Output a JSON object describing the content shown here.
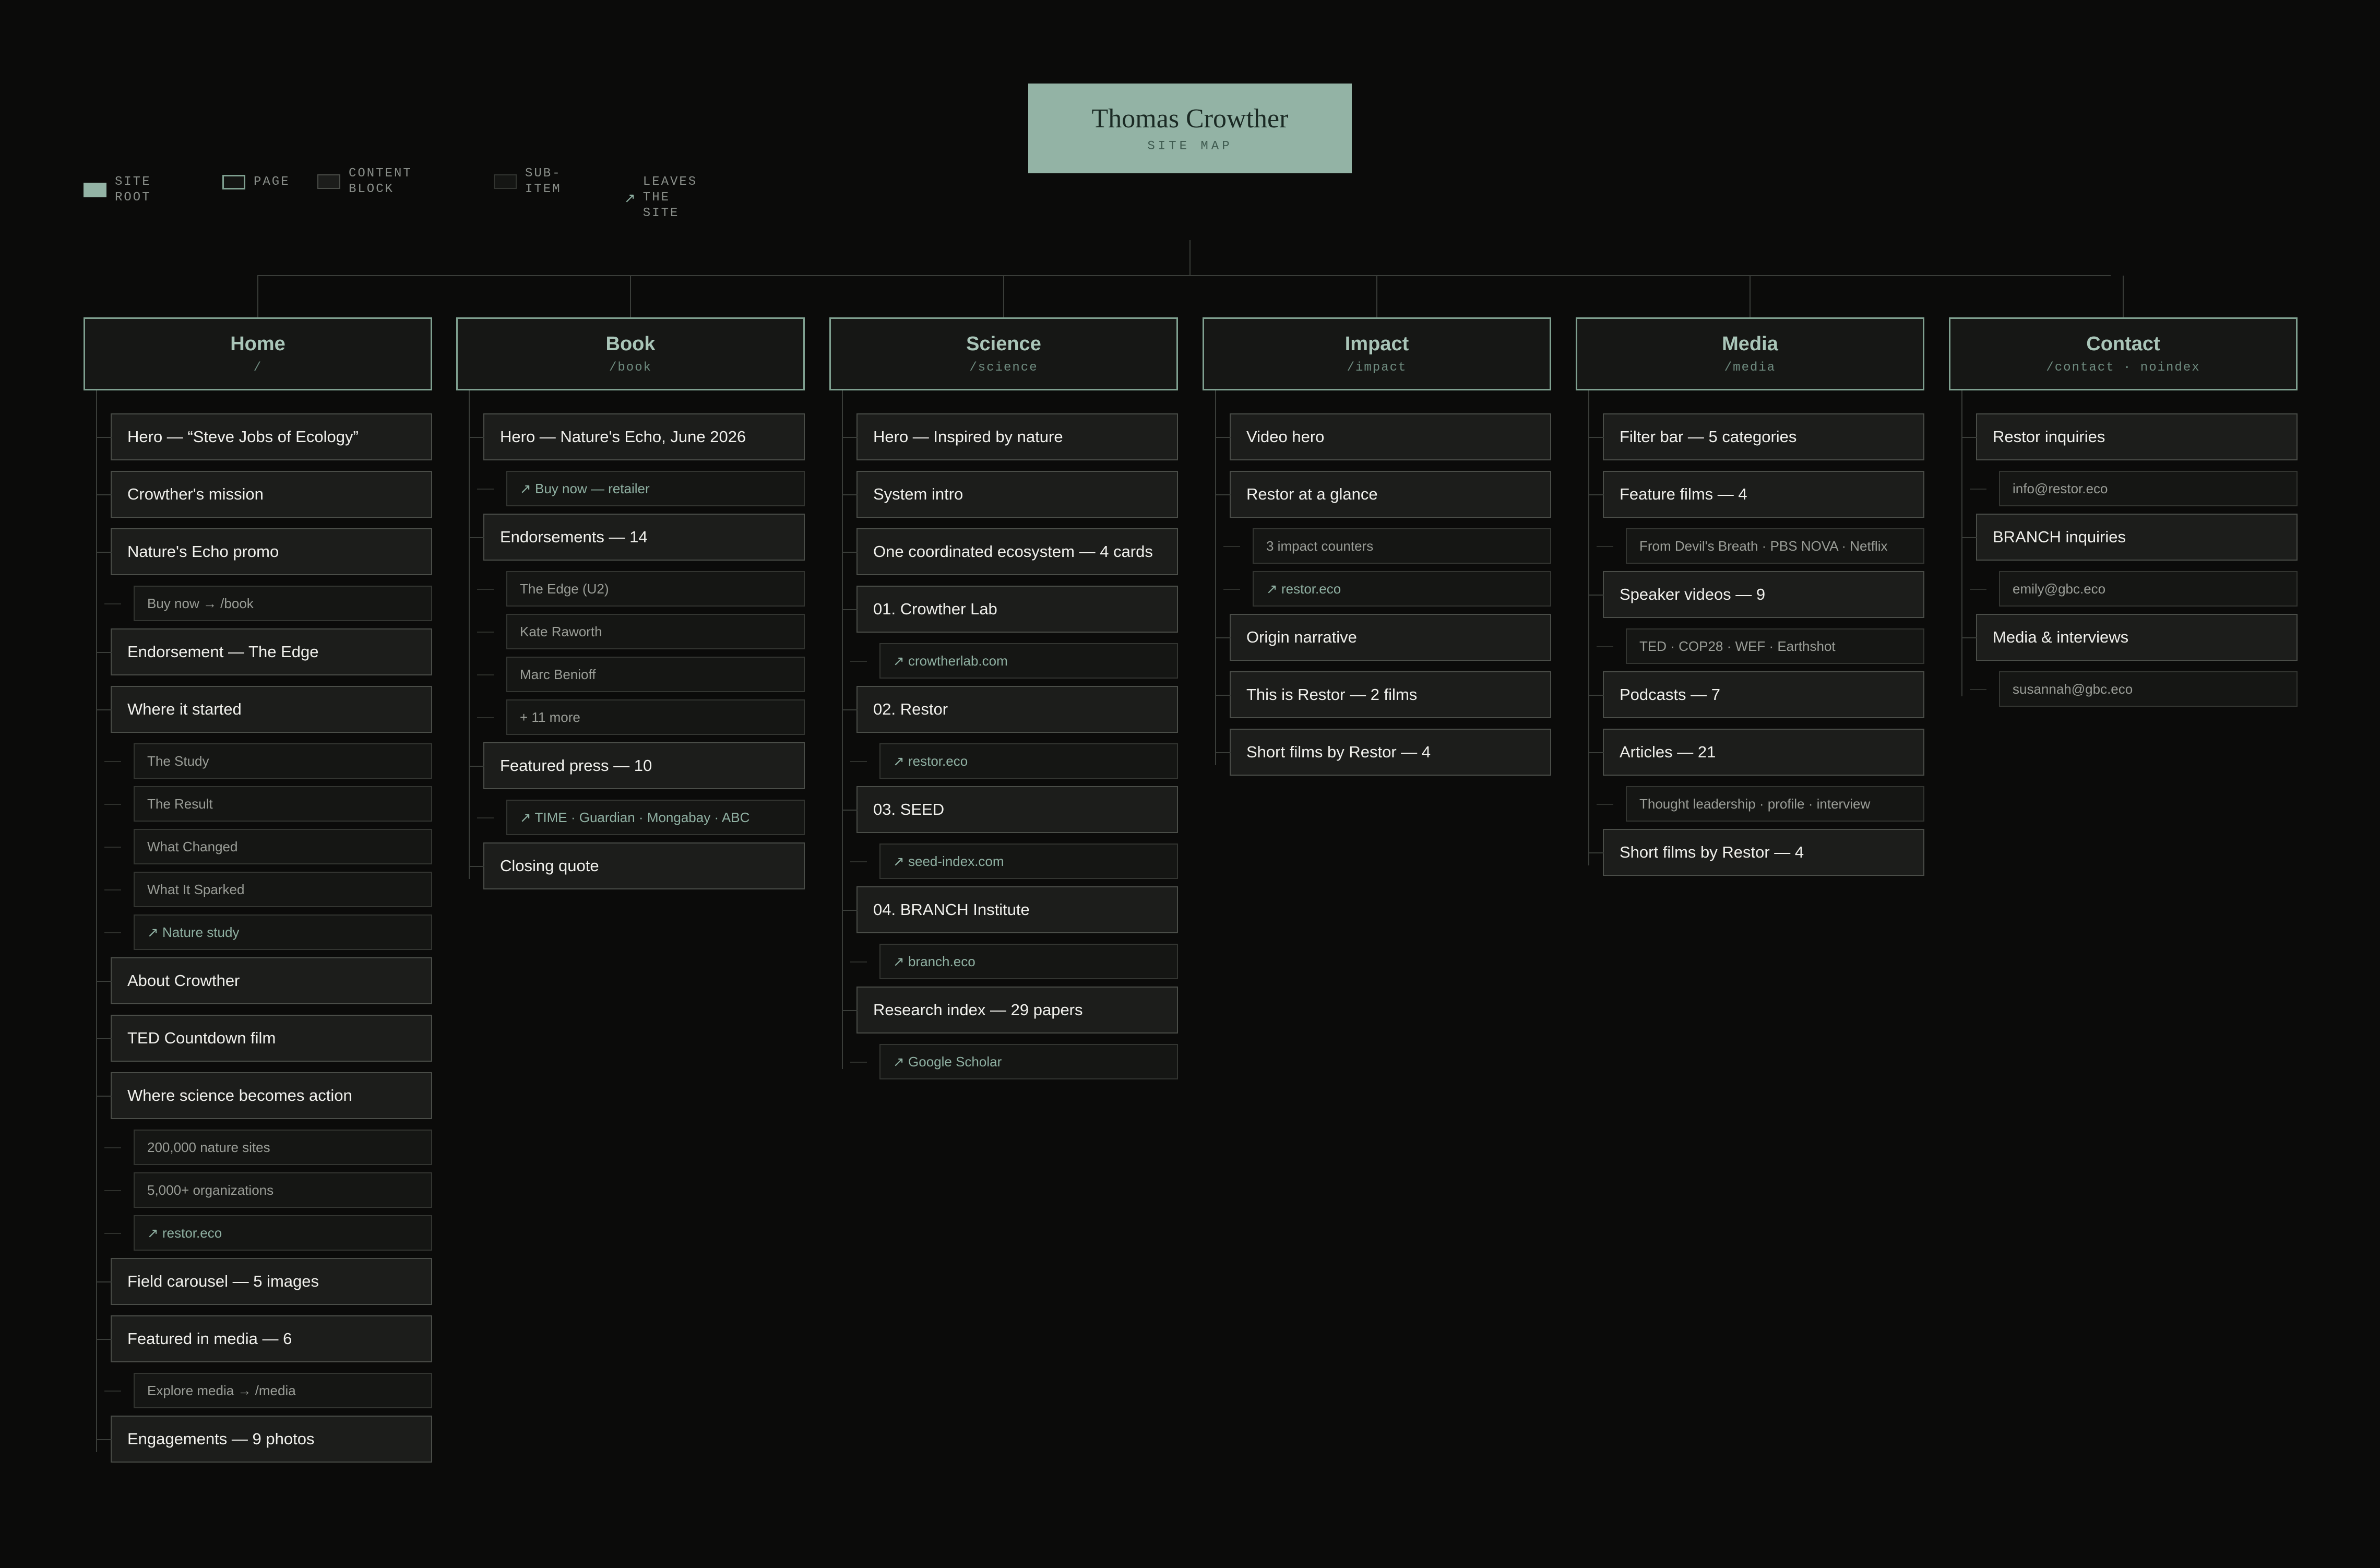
{
  "root": {
    "title": "Thomas Crowther",
    "subtitle": "SITE MAP"
  },
  "legend": [
    {
      "kind": "root",
      "label": "SITE ROOT"
    },
    {
      "kind": "page",
      "label": "PAGE"
    },
    {
      "kind": "block",
      "label": "CONTENT\nBLOCK"
    },
    {
      "kind": "sub",
      "label": "SUB-\nITEM"
    },
    {
      "kind": "arrow",
      "icon": "↗",
      "label": "LEAVES THE SITE"
    }
  ],
  "pages": [
    {
      "title": "Home",
      "path": "/",
      "items": [
        {
          "type": "block",
          "text": "Hero — “Steve Jobs of Ecology”"
        },
        {
          "type": "block",
          "text": "Crowther's mission"
        },
        {
          "type": "block",
          "text": "Nature's Echo promo"
        },
        {
          "type": "sub",
          "text": "Buy now → /book"
        },
        {
          "type": "block",
          "text": "Endorsement — The Edge"
        },
        {
          "type": "block",
          "text": "Where it started"
        },
        {
          "type": "sub",
          "text": "The Study"
        },
        {
          "type": "sub",
          "text": "The Result"
        },
        {
          "type": "sub",
          "text": "What Changed"
        },
        {
          "type": "sub",
          "text": "What It Sparked"
        },
        {
          "type": "sub",
          "ext": true,
          "text": "↗ Nature study"
        },
        {
          "type": "block",
          "text": "About Crowther"
        },
        {
          "type": "block",
          "text": "TED Countdown film"
        },
        {
          "type": "block",
          "text": "Where science becomes action"
        },
        {
          "type": "sub",
          "text": "200,000 nature sites"
        },
        {
          "type": "sub",
          "text": "5,000+ organizations"
        },
        {
          "type": "sub",
          "ext": true,
          "text": "↗ restor.eco"
        },
        {
          "type": "block",
          "text": "Field carousel — 5 images"
        },
        {
          "type": "block",
          "text": "Featured in media — 6"
        },
        {
          "type": "sub",
          "text": "Explore media → /media"
        },
        {
          "type": "block",
          "text": "Engagements — 9 photos"
        }
      ]
    },
    {
      "title": "Book",
      "path": "/book",
      "items": [
        {
          "type": "block",
          "text": "Hero — Nature's Echo, June 2026"
        },
        {
          "type": "sub",
          "ext": true,
          "text": "↗ Buy now — retailer"
        },
        {
          "type": "block",
          "text": "Endorsements — 14"
        },
        {
          "type": "sub",
          "text": "The Edge (U2)"
        },
        {
          "type": "sub",
          "text": "Kate Raworth"
        },
        {
          "type": "sub",
          "text": "Marc Benioff"
        },
        {
          "type": "sub",
          "text": "+ 11 more"
        },
        {
          "type": "block",
          "text": "Featured press — 10"
        },
        {
          "type": "sub",
          "ext": true,
          "text": "↗ TIME · Guardian · Mongabay · ABC"
        },
        {
          "type": "block",
          "text": "Closing quote"
        }
      ]
    },
    {
      "title": "Science",
      "path": "/science",
      "items": [
        {
          "type": "block",
          "text": "Hero — Inspired by nature"
        },
        {
          "type": "block",
          "text": "System intro"
        },
        {
          "type": "block",
          "text": "One coordinated ecosystem — 4 cards"
        },
        {
          "type": "block",
          "text": "01. Crowther Lab"
        },
        {
          "type": "sub",
          "ext": true,
          "text": "↗ crowtherlab.com"
        },
        {
          "type": "block",
          "text": "02. Restor"
        },
        {
          "type": "sub",
          "ext": true,
          "text": "↗ restor.eco"
        },
        {
          "type": "block",
          "text": "03. SEED"
        },
        {
          "type": "sub",
          "ext": true,
          "text": "↗ seed-index.com"
        },
        {
          "type": "block",
          "text": "04. BRANCH Institute"
        },
        {
          "type": "sub",
          "ext": true,
          "text": "↗ branch.eco"
        },
        {
          "type": "block",
          "text": "Research index — 29 papers"
        },
        {
          "type": "sub",
          "ext": true,
          "text": "↗ Google Scholar"
        }
      ]
    },
    {
      "title": "Impact",
      "path": "/impact",
      "items": [
        {
          "type": "block",
          "text": "Video hero"
        },
        {
          "type": "block",
          "text": "Restor at a glance"
        },
        {
          "type": "sub",
          "text": "3 impact counters"
        },
        {
          "type": "sub",
          "ext": true,
          "text": "↗ restor.eco"
        },
        {
          "type": "block",
          "text": "Origin narrative"
        },
        {
          "type": "block",
          "text": "This is Restor — 2 films"
        },
        {
          "type": "block",
          "text": "Short films by Restor — 4"
        }
      ]
    },
    {
      "title": "Media",
      "path": "/media",
      "items": [
        {
          "type": "block",
          "text": "Filter bar — 5 categories"
        },
        {
          "type": "block",
          "text": "Feature films — 4"
        },
        {
          "type": "sub",
          "text": "From Devil's Breath · PBS NOVA · Netflix"
        },
        {
          "type": "block",
          "text": "Speaker videos — 9"
        },
        {
          "type": "sub",
          "text": "TED · COP28 · WEF · Earthshot"
        },
        {
          "type": "block",
          "text": "Podcasts — 7"
        },
        {
          "type": "block",
          "text": "Articles — 21"
        },
        {
          "type": "sub",
          "text": "Thought leadership · profile · interview"
        },
        {
          "type": "block",
          "text": "Short films by Restor — 4"
        }
      ]
    },
    {
      "title": "Contact",
      "path": "/contact · noindex",
      "items": [
        {
          "type": "block",
          "text": "Restor inquiries"
        },
        {
          "type": "sub",
          "text": "info@restor.eco"
        },
        {
          "type": "block",
          "text": "BRANCH inquiries"
        },
        {
          "type": "sub",
          "text": "emily@gbc.eco"
        },
        {
          "type": "block",
          "text": "Media & interviews"
        },
        {
          "type": "sub",
          "text": "susannah@gbc.eco"
        }
      ]
    }
  ]
}
